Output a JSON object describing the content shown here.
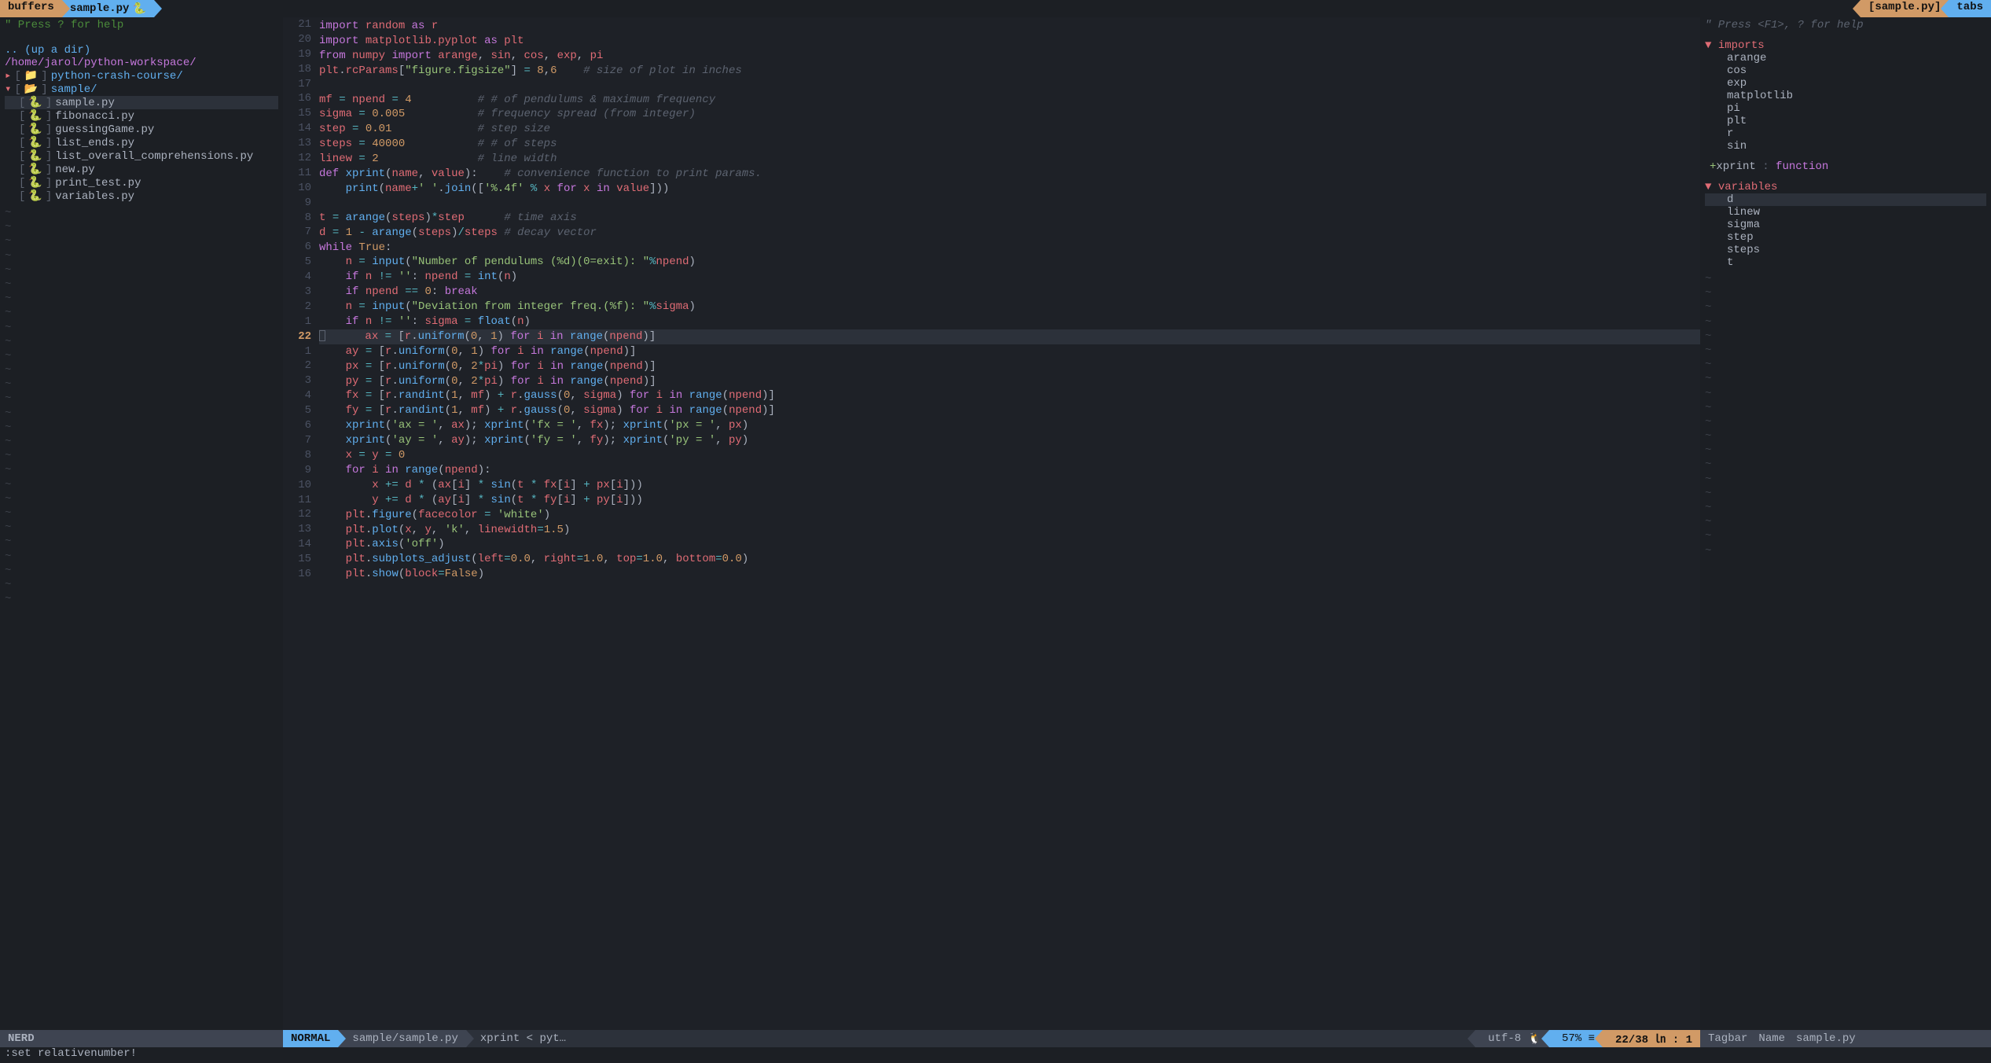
{
  "tabs": {
    "buffers_label": "buffers",
    "left_active": "sample.py",
    "py_glyph": "🐍",
    "right_active": "[sample.py]",
    "tabs_label": "tabs"
  },
  "nerdtree": {
    "help": "\" Press ? for help",
    "updir": ".. (up a dir)",
    "path": "/home/jarol/python-workspace/",
    "dir1": {
      "arrow": "▸",
      "name": "python-crash-course/"
    },
    "dir2": {
      "arrow": "▾",
      "name": "sample/"
    },
    "files": [
      "sample.py",
      "fibonacci.py",
      "guessingGame.py",
      "list_ends.py",
      "list_overall_comprehensions.py",
      "new.py",
      "print_test.py",
      "variables.py"
    ],
    "status": "NERD"
  },
  "editor": {
    "gutter": [
      "21",
      "20",
      "19",
      "18",
      "17",
      "16",
      "15",
      "14",
      "13",
      "12",
      "11",
      "10",
      "9",
      "8",
      "7",
      "6",
      "5",
      "4",
      "3",
      "2",
      "1",
      "22",
      "1",
      "2",
      "3",
      "4",
      "5",
      "6",
      "7",
      "8",
      "9",
      "10",
      "11",
      "12",
      "13",
      "14",
      "15",
      "16"
    ],
    "current_index": 21,
    "lines_html": [
      "<span class='kw'>import</span> <span class='id'>random</span> <span class='kw'>as</span> <span class='id'>r</span>",
      "<span class='kw'>import</span> <span class='id'>matplotlib.pyplot</span> <span class='kw'>as</span> <span class='id'>plt</span>",
      "<span class='kw'>from</span> <span class='id'>numpy</span> <span class='kw'>import</span> <span class='id'>arange</span>, <span class='id'>sin</span>, <span class='id'>cos</span>, <span class='id'>exp</span>, <span class='id'>pi</span>",
      "<span class='id'>plt</span>.<span class='id'>rcParams</span>[<span class='str'>\"figure.figsize\"</span>] <span class='op'>=</span> <span class='num'>8</span>,<span class='num'>6</span>    <span class='cm'># size of plot in inches</span>",
      "",
      "<span class='id'>mf</span> <span class='op'>=</span> <span class='id'>npend</span> <span class='op'>=</span> <span class='num'>4</span>          <span class='cm'># # of pendulums & maximum frequency</span>",
      "<span class='id'>sigma</span> <span class='op'>=</span> <span class='num'>0.005</span>           <span class='cm'># frequency spread (from integer)</span>",
      "<span class='id'>step</span> <span class='op'>=</span> <span class='num'>0.01</span>             <span class='cm'># step size</span>",
      "<span class='id'>steps</span> <span class='op'>=</span> <span class='num'>40000</span>           <span class='cm'># # of steps</span>",
      "<span class='id'>linew</span> <span class='op'>=</span> <span class='num'>2</span>               <span class='cm'># line width</span>",
      "<span class='kw'>def</span> <span class='fn'>xprint</span>(<span class='id'>name</span>, <span class='id'>value</span>):    <span class='cm'># convenience function to print params.</span>",
      "    <span class='fn'>print</span>(<span class='id'>name</span><span class='op'>+</span><span class='str'>' '</span>.<span class='fn'>join</span>([<span class='str'>'%.4f'</span> <span class='op'>%</span> <span class='id'>x</span> <span class='kw'>for</span> <span class='id'>x</span> <span class='kw'>in</span> <span class='id'>value</span>]))",
      "",
      "<span class='id'>t</span> <span class='op'>=</span> <span class='fn'>arange</span>(<span class='id'>steps</span>)<span class='op'>*</span><span class='id'>step</span>      <span class='cm'># time axis</span>",
      "<span class='id'>d</span> <span class='op'>=</span> <span class='num'>1</span> <span class='op'>-</span> <span class='fn'>arange</span>(<span class='id'>steps</span>)<span class='op'>/</span><span class='id'>steps</span> <span class='cm'># decay vector</span>",
      "<span class='kw'>while</span> <span class='bool'>True</span>:",
      "    <span class='id'>n</span> <span class='op'>=</span> <span class='fn'>input</span>(<span class='str'>\"Number of pendulums (%d)(0=exit): \"</span><span class='op'>%</span><span class='id'>npend</span>)",
      "    <span class='kw'>if</span> <span class='id'>n</span> <span class='op'>!=</span> <span class='str'>''</span>: <span class='id'>npend</span> <span class='op'>=</span> <span class='fn'>int</span>(<span class='id'>n</span>)",
      "    <span class='kw'>if</span> <span class='id'>npend</span> <span class='op'>==</span> <span class='num'>0</span>: <span class='kw'>break</span>",
      "    <span class='id'>n</span> <span class='op'>=</span> <span class='fn'>input</span>(<span class='str'>\"Deviation from integer freq.(%f): \"</span><span class='op'>%</span><span class='id'>sigma</span>)",
      "    <span class='kw'>if</span> <span class='id'>n</span> <span class='op'>!=</span> <span class='str'>''</span>: <span class='id'>sigma</span> <span class='op'>=</span> <span class='fn'>float</span>(<span class='id'>n</span>)",
      "    <span class='id'>ax</span> <span class='op'>=</span> [<span class='id'>r</span>.<span class='fn'>uniform</span>(<span class='num'>0</span>, <span class='num'>1</span>) <span class='kw'>for</span> <span class='id'>i</span> <span class='kw'>in</span> <span class='fn'>range</span>(<span class='id'>npend</span>)]",
      "    <span class='id'>ay</span> <span class='op'>=</span> [<span class='id'>r</span>.<span class='fn'>uniform</span>(<span class='num'>0</span>, <span class='num'>1</span>) <span class='kw'>for</span> <span class='id'>i</span> <span class='kw'>in</span> <span class='fn'>range</span>(<span class='id'>npend</span>)]",
      "    <span class='id'>px</span> <span class='op'>=</span> [<span class='id'>r</span>.<span class='fn'>uniform</span>(<span class='num'>0</span>, <span class='num'>2</span><span class='op'>*</span><span class='id'>pi</span>) <span class='kw'>for</span> <span class='id'>i</span> <span class='kw'>in</span> <span class='fn'>range</span>(<span class='id'>npend</span>)]",
      "    <span class='id'>py</span> <span class='op'>=</span> [<span class='id'>r</span>.<span class='fn'>uniform</span>(<span class='num'>0</span>, <span class='num'>2</span><span class='op'>*</span><span class='id'>pi</span>) <span class='kw'>for</span> <span class='id'>i</span> <span class='kw'>in</span> <span class='fn'>range</span>(<span class='id'>npend</span>)]",
      "    <span class='id'>fx</span> <span class='op'>=</span> [<span class='id'>r</span>.<span class='fn'>randint</span>(<span class='num'>1</span>, <span class='id'>mf</span>) <span class='op'>+</span> <span class='id'>r</span>.<span class='fn'>gauss</span>(<span class='num'>0</span>, <span class='id'>sigma</span>) <span class='kw'>for</span> <span class='id'>i</span> <span class='kw'>in</span> <span class='fn'>range</span>(<span class='id'>npend</span>)]",
      "    <span class='id'>fy</span> <span class='op'>=</span> [<span class='id'>r</span>.<span class='fn'>randint</span>(<span class='num'>1</span>, <span class='id'>mf</span>) <span class='op'>+</span> <span class='id'>r</span>.<span class='fn'>gauss</span>(<span class='num'>0</span>, <span class='id'>sigma</span>) <span class='kw'>for</span> <span class='id'>i</span> <span class='kw'>in</span> <span class='fn'>range</span>(<span class='id'>npend</span>)]",
      "    <span class='fn'>xprint</span>(<span class='str'>'ax = '</span>, <span class='id'>ax</span>); <span class='fn'>xprint</span>(<span class='str'>'fx = '</span>, <span class='id'>fx</span>); <span class='fn'>xprint</span>(<span class='str'>'px = '</span>, <span class='id'>px</span>)",
      "    <span class='fn'>xprint</span>(<span class='str'>'ay = '</span>, <span class='id'>ay</span>); <span class='fn'>xprint</span>(<span class='str'>'fy = '</span>, <span class='id'>fy</span>); <span class='fn'>xprint</span>(<span class='str'>'py = '</span>, <span class='id'>py</span>)",
      "    <span class='id'>x</span> <span class='op'>=</span> <span class='id'>y</span> <span class='op'>=</span> <span class='num'>0</span>",
      "    <span class='kw'>for</span> <span class='id'>i</span> <span class='kw'>in</span> <span class='fn'>range</span>(<span class='id'>npend</span>):",
      "        <span class='id'>x</span> <span class='op'>+=</span> <span class='id'>d</span> <span class='op'>*</span> (<span class='id'>ax</span>[<span class='id'>i</span>] <span class='op'>*</span> <span class='fn'>sin</span>(<span class='id'>t</span> <span class='op'>*</span> <span class='id'>fx</span>[<span class='id'>i</span>] <span class='op'>+</span> <span class='id'>px</span>[<span class='id'>i</span>]))",
      "        <span class='id'>y</span> <span class='op'>+=</span> <span class='id'>d</span> <span class='op'>*</span> (<span class='id'>ay</span>[<span class='id'>i</span>] <span class='op'>*</span> <span class='fn'>sin</span>(<span class='id'>t</span> <span class='op'>*</span> <span class='id'>fy</span>[<span class='id'>i</span>] <span class='op'>+</span> <span class='id'>py</span>[<span class='id'>i</span>]))",
      "    <span class='id'>plt</span>.<span class='fn'>figure</span>(<span class='id'>facecolor</span> <span class='op'>=</span> <span class='str'>'white'</span>)",
      "    <span class='id'>plt</span>.<span class='fn'>plot</span>(<span class='id'>x</span>, <span class='id'>y</span>, <span class='str'>'k'</span>, <span class='id'>linewidth</span><span class='op'>=</span><span class='num'>1.5</span>)",
      "    <span class='id'>plt</span>.<span class='fn'>axis</span>(<span class='str'>'off'</span>)",
      "    <span class='id'>plt</span>.<span class='fn'>subplots_adjust</span>(<span class='id'>left</span><span class='op'>=</span><span class='num'>0.0</span>, <span class='id'>right</span><span class='op'>=</span><span class='num'>1.0</span>, <span class='id'>top</span><span class='op'>=</span><span class='num'>1.0</span>, <span class='id'>bottom</span><span class='op'>=</span><span class='num'>0.0</span>)",
      "    <span class='id'>plt</span>.<span class='fn'>show</span>(<span class='id'>block</span><span class='op'>=</span><span class='bool'>False</span>)"
    ]
  },
  "tagbar": {
    "help": "\" Press <F1>, ? for help",
    "sections": {
      "imports": {
        "label": "imports",
        "items": [
          "arange",
          "cos",
          "exp",
          "matplotlib",
          "pi",
          "plt",
          "r",
          "sin"
        ]
      },
      "func": "+xprint : function",
      "variables": {
        "label": "variables",
        "items": [
          "d",
          "linew",
          "sigma",
          "step",
          "steps",
          "t"
        ],
        "selected": 0
      }
    },
    "status": {
      "label": "Tagbar",
      "middle": "Name",
      "file": "sample.py"
    }
  },
  "statusbar": {
    "mode": "NORMAL",
    "file": "sample/sample.py",
    "func": "xprint < pyt…",
    "encoding": "utf-8",
    "linux_glyph": "🐧",
    "percent": "57% ≡",
    "pos": "22/38 ㏑ : 1 "
  },
  "cmdline": ":set relativenumber!"
}
